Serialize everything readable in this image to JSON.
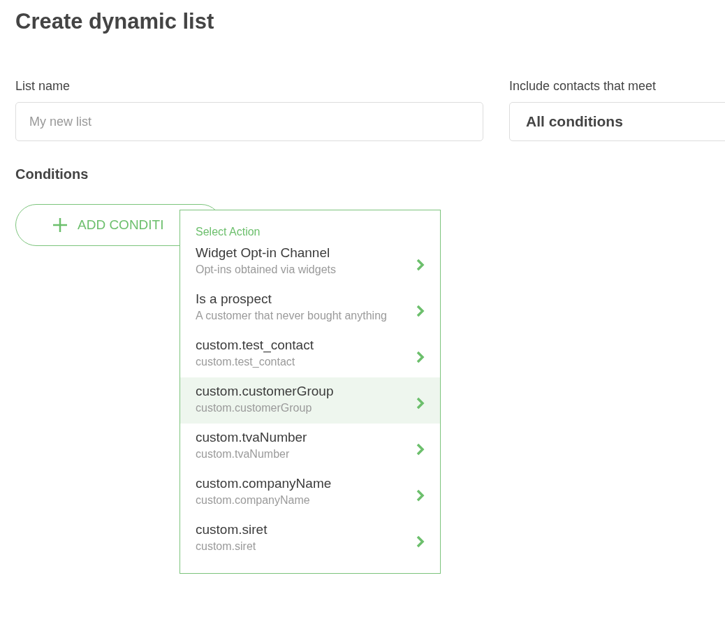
{
  "title": "Create dynamic list",
  "list_name": {
    "label": "List name",
    "placeholder": "My new list"
  },
  "include": {
    "label": "Include contacts that meet",
    "value": "All conditions"
  },
  "conditions": {
    "heading": "Conditions",
    "add_button": "ADD CONDITI"
  },
  "menu": {
    "header": "Select Action",
    "items": [
      {
        "title": "Widget Opt-in Channel",
        "subtitle": "Opt-ins obtained via widgets",
        "selected": false
      },
      {
        "title": "Is a prospect",
        "subtitle": "A customer that never bought anything",
        "selected": false
      },
      {
        "title": "custom.test_contact",
        "subtitle": "custom.test_contact",
        "selected": false
      },
      {
        "title": "custom.customerGroup",
        "subtitle": "custom.customerGroup",
        "selected": true
      },
      {
        "title": "custom.tvaNumber",
        "subtitle": "custom.tvaNumber",
        "selected": false
      },
      {
        "title": "custom.companyName",
        "subtitle": "custom.companyName",
        "selected": false
      },
      {
        "title": "custom.siret",
        "subtitle": "custom.siret",
        "selected": false
      }
    ]
  }
}
